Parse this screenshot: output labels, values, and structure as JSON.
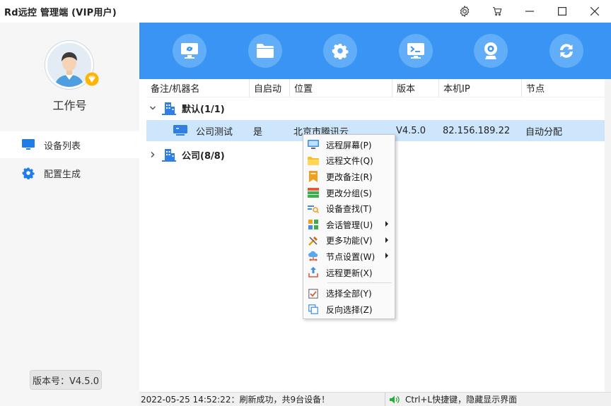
{
  "window": {
    "title": "Rd远控 管理端 (VIP用户)"
  },
  "sidebar": {
    "work_label": "工作号",
    "nav": [
      {
        "label": "设备列表",
        "icon": "monitor-icon"
      },
      {
        "label": "配置生成",
        "icon": "gear-icon"
      }
    ],
    "version": "版本号：V4.5.0"
  },
  "toolbar": {
    "buttons": [
      "remote-screen-icon",
      "folder-icon",
      "gear-icon",
      "terminal-icon",
      "webcam-icon",
      "refresh-icon"
    ]
  },
  "table": {
    "columns": [
      "备注/机器名",
      "自启动",
      "位置",
      "版本",
      "本机IP",
      "节点"
    ],
    "groups": [
      {
        "label": "默认(1/1)",
        "expanded": true
      },
      {
        "label": "公司(8/8)",
        "expanded": false
      }
    ],
    "device": {
      "name": "公司测试",
      "autostart": "是",
      "location": "北京市腾讯云",
      "version": "V4.5.0",
      "ip": "82.156.189.22",
      "node": "自动分配"
    }
  },
  "context_menu": {
    "items": [
      {
        "label": "远程屏幕(P)",
        "icon": "screen-icon",
        "submenu": false
      },
      {
        "label": "远程文件(Q)",
        "icon": "folder-icon",
        "submenu": false
      },
      {
        "label": "更改备注(R)",
        "icon": "bookmark-icon",
        "submenu": false
      },
      {
        "label": "更改分组(S)",
        "icon": "group-icon",
        "submenu": false
      },
      {
        "label": "设备查找(T)",
        "icon": "search-device-icon",
        "submenu": false
      },
      {
        "label": "会话管理(U)",
        "icon": "session-icon",
        "submenu": true
      },
      {
        "label": "更多功能(V)",
        "icon": "tools-icon",
        "submenu": true
      },
      {
        "label": "节点设置(W)",
        "icon": "cloud-icon",
        "submenu": true
      },
      {
        "label": "远程更新(X)",
        "icon": "upload-icon",
        "submenu": false
      },
      {
        "label": "选择全部(Y)",
        "icon": "checkbox-icon",
        "submenu": false
      },
      {
        "label": "反向选择(Z)",
        "icon": "invert-select-icon",
        "submenu": false
      }
    ]
  },
  "status": {
    "left": "2022-05-25 14:52:22：刷新成功，共9台设备！",
    "right": "Ctrl+L快捷键，隐藏显示界面"
  },
  "colors": {
    "accent": "#3a94f3",
    "selection": "#cde6fb"
  }
}
